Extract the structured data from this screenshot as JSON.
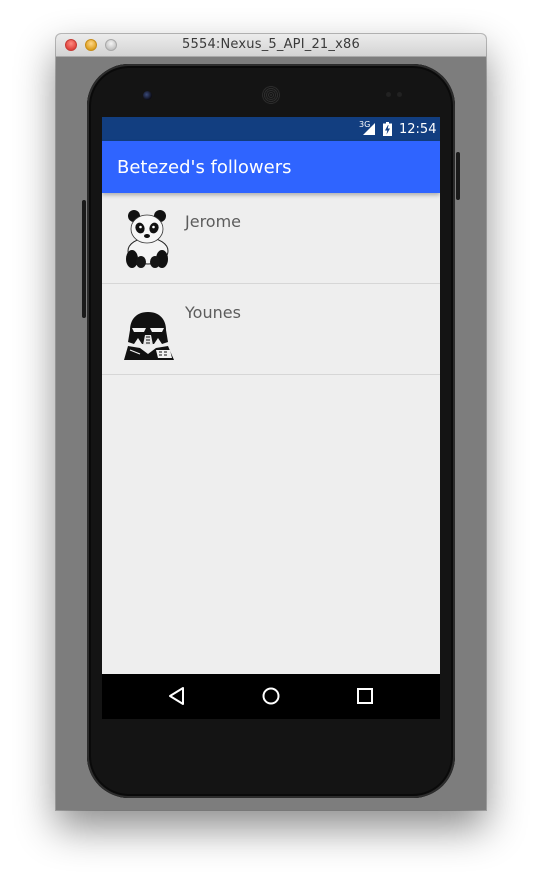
{
  "window": {
    "title": "5554:Nexus_5_API_21_x86"
  },
  "statusbar": {
    "network": "3G",
    "time": "12:54"
  },
  "appbar": {
    "title": "Betezed's followers"
  },
  "followers": [
    {
      "name": "Jerome",
      "avatar": "panda-avatar"
    },
    {
      "name": "Younes",
      "avatar": "darth-vader-avatar"
    }
  ],
  "colors": {
    "statusbar": "#123e80",
    "appbar": "#2f64ff",
    "background": "#eeeeee",
    "navbar": "#000000"
  },
  "navbar": {
    "buttons": [
      "back-icon",
      "home-icon",
      "recents-icon"
    ]
  }
}
